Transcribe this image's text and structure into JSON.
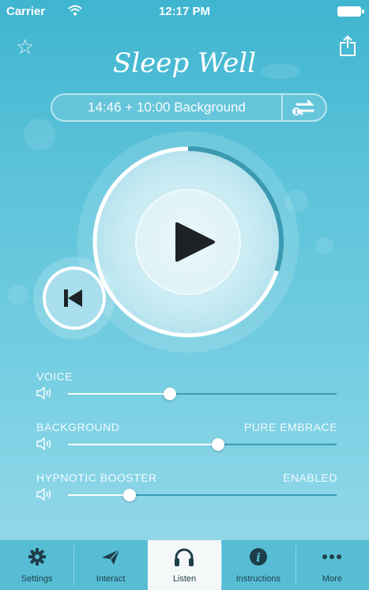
{
  "status_bar": {
    "carrier": "Carrier",
    "time": "12:17 PM"
  },
  "header": {
    "title": "Sleep Well",
    "favorite_icon": "star-outline-icon",
    "share_icon": "share-icon"
  },
  "session": {
    "duration_label": "14:46 + 10:00 Background",
    "toggle_icon": "loop-toggle-icon"
  },
  "player": {
    "state": "paused",
    "play_icon": "play-icon",
    "restart_icon": "skip-back-icon",
    "progress_fraction": 0.3
  },
  "sliders": [
    {
      "label": "VOICE",
      "value_label": "",
      "level": 0.38
    },
    {
      "label": "BACKGROUND",
      "value_label": "PURE EMBRACE",
      "level": 0.56
    },
    {
      "label": "HYPNOTIC BOOSTER",
      "value_label": "ENABLED",
      "level": 0.23
    }
  ],
  "tabs": [
    {
      "label": "Settings",
      "icon": "gear-icon",
      "active": false
    },
    {
      "label": "Interact",
      "icon": "paper-plane-icon",
      "active": false
    },
    {
      "label": "Listen",
      "icon": "headphones-icon",
      "active": true
    },
    {
      "label": "Instructions",
      "icon": "info-icon",
      "active": false
    },
    {
      "label": "More",
      "icon": "more-icon",
      "active": false
    }
  ],
  "colors": {
    "background_top": "#3fb5cf",
    "background_bottom": "#9ad9e8",
    "accent_dark": "#3b9ab1",
    "tab_text": "#1e3e4a"
  }
}
